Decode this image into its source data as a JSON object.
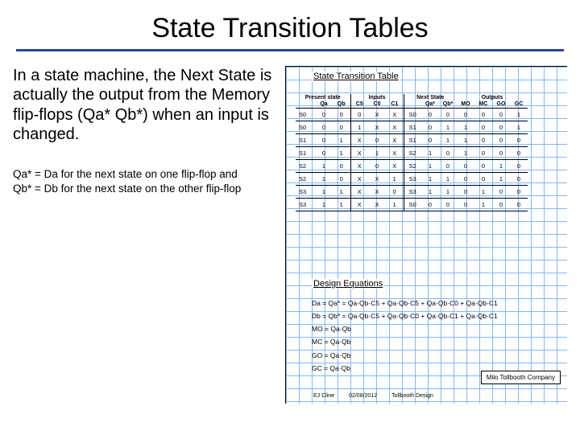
{
  "title": "State Transition Tables",
  "paragraph": "In a state machine, the Next State is actually the output from the Memory flip-flops (Qa* Qb*) when an input is changed.",
  "note1": "Qa* = Da for the next state on one flip-flop and",
  "note2": "Qb* = Db for the next state on the other flip-flop",
  "diagram": {
    "tableTitle": "State Transition Table",
    "group": {
      "present": "Present state",
      "inputs": "Inputs",
      "next": "Next State",
      "outputs": "Outputs"
    },
    "cols": [
      "",
      "Qa",
      "Qb",
      "C5",
      "C0",
      "C1",
      "",
      "Qa*",
      "Qb*",
      "MO",
      "MC",
      "GO",
      "GC"
    ],
    "rows": [
      [
        "S0",
        "0",
        "0",
        "0",
        "X",
        "X",
        "S0",
        "0",
        "0",
        "0",
        "0",
        "0",
        "1"
      ],
      [
        "S0",
        "0",
        "0",
        "1",
        "X",
        "X",
        "S1",
        "0",
        "1",
        "1",
        "0",
        "0",
        "1"
      ],
      [
        "S1",
        "0",
        "1",
        "X",
        "0",
        "X",
        "S1",
        "0",
        "1",
        "1",
        "0",
        "0",
        "0"
      ],
      [
        "S1",
        "0",
        "1",
        "X",
        "1",
        "X",
        "S2",
        "1",
        "0",
        "1",
        "0",
        "0",
        "0"
      ],
      [
        "S2",
        "1",
        "0",
        "X",
        "0",
        "X",
        "S2",
        "1",
        "0",
        "0",
        "0",
        "1",
        "0"
      ],
      [
        "S2",
        "1",
        "0",
        "X",
        "X",
        "1",
        "S3",
        "1",
        "1",
        "0",
        "0",
        "1",
        "0"
      ],
      [
        "S3",
        "1",
        "1",
        "X",
        "X",
        "0",
        "S3",
        "1",
        "1",
        "0",
        "1",
        "0",
        "0"
      ],
      [
        "S3",
        "1",
        "1",
        "X",
        "X",
        "1",
        "S0",
        "0",
        "0",
        "0",
        "1",
        "0",
        "0"
      ]
    ],
    "eqTitle": "Design Equations",
    "eq": {
      "da": "Da = Qa* = Qa·Qb·C5 + Qa·Qb·C5 + Qa·Qb·C0 + Qa·Qb·C1",
      "db": "Db = Qb* = Qa·Qb·C5 + Qa·Qb·C0 + Qa·Qb·C1 + Qa·Qb·C1",
      "mo": "MO = Qa·Qb",
      "mc": "MC = Qa·Qb",
      "go": "GO = Qa·Qb",
      "gc": "GC = Qa·Qb"
    },
    "titlebox": "Milo Tollbooth Company",
    "footer1": "EJ Cline",
    "footer2": "02/08/2012",
    "footer3": "Tollbooth Design"
  }
}
